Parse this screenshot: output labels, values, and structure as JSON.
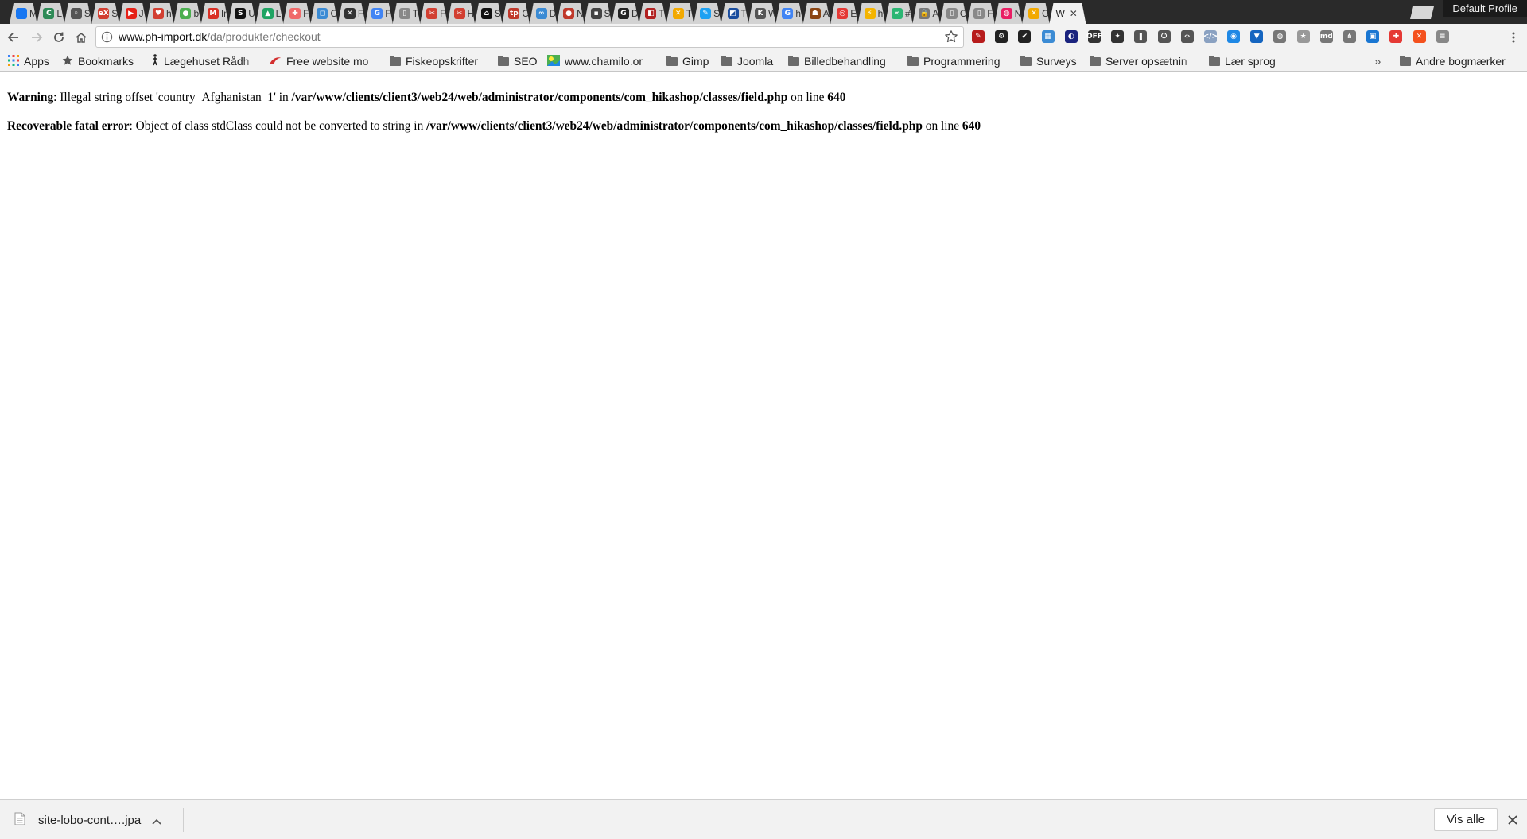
{
  "browser": {
    "profile_label": "Default Profile",
    "tabs": [
      {
        "glyph": "",
        "color": "#1877f2",
        "label": "M"
      },
      {
        "glyph": "C",
        "color": "#2e8b57",
        "label": "L"
      },
      {
        "glyph": "◦",
        "color": "#555555",
        "label": "S"
      },
      {
        "glyph": "eX",
        "color": "#d23f31",
        "label": "S"
      },
      {
        "glyph": "▶",
        "color": "#e62117",
        "label": "J"
      },
      {
        "glyph": "♥",
        "color": "#d23f31",
        "label": "h"
      },
      {
        "glyph": "●",
        "color": "#4caf50",
        "label": "b"
      },
      {
        "glyph": "M",
        "color": "#d93025",
        "label": "In"
      },
      {
        "glyph": "S",
        "color": "#111111",
        "label": "U"
      },
      {
        "glyph": "▲",
        "color": "#1fa463",
        "label": "L"
      },
      {
        "glyph": "✚",
        "color": "#f06a6a",
        "label": "F"
      },
      {
        "glyph": "◻",
        "color": "#3b8bd4",
        "label": "C"
      },
      {
        "glyph": "✕",
        "color": "#333333",
        "label": "F"
      },
      {
        "glyph": "G",
        "color": "#4285f4",
        "label": "F"
      },
      {
        "glyph": "▯",
        "color": "#888888",
        "label": "T"
      },
      {
        "glyph": "✂",
        "color": "#d23f31",
        "label": "F"
      },
      {
        "glyph": "✂",
        "color": "#d23f31",
        "label": "H"
      },
      {
        "glyph": "⌂",
        "color": "#111111",
        "label": "S"
      },
      {
        "glyph": "tp",
        "color": "#c0392b",
        "label": "C"
      },
      {
        "glyph": "∞",
        "color": "#3b8bd4",
        "label": "D"
      },
      {
        "glyph": "●",
        "color": "#c0392b",
        "label": "N"
      },
      {
        "glyph": "▪",
        "color": "#444444",
        "label": "S"
      },
      {
        "glyph": "G",
        "color": "#222222",
        "label": "D"
      },
      {
        "glyph": "◧",
        "color": "#b22222",
        "label": "T"
      },
      {
        "glyph": "✕",
        "color": "#f2a900",
        "label": "T"
      },
      {
        "glyph": "✎",
        "color": "#1da1f2",
        "label": "S"
      },
      {
        "glyph": "◩",
        "color": "#1a4d9e",
        "label": "T"
      },
      {
        "glyph": "K",
        "color": "#555555",
        "label": "W"
      },
      {
        "glyph": "G",
        "color": "#4285f4",
        "label": "h"
      },
      {
        "glyph": "☗",
        "color": "#8b4513",
        "label": "A"
      },
      {
        "glyph": "◎",
        "color": "#e53935",
        "label": "E"
      },
      {
        "glyph": "⚡",
        "color": "#f4b400",
        "label": "h"
      },
      {
        "glyph": "∞",
        "color": "#2bb673",
        "label": "#"
      },
      {
        "glyph": "🔒",
        "color": "#777777",
        "label": "A"
      },
      {
        "glyph": "▯",
        "color": "#888888",
        "label": "C"
      },
      {
        "glyph": "▯",
        "color": "#888888",
        "label": "F"
      },
      {
        "glyph": "◍",
        "color": "#e91e63",
        "label": "N"
      },
      {
        "glyph": "✕",
        "color": "#f2a900",
        "label": "C"
      }
    ],
    "active_tab": {
      "label": "W",
      "close": "✕"
    },
    "url_host": "www.ph-import.dk",
    "url_path": "/da/produkter/checkout",
    "extensions": [
      {
        "name": "eyedropper-ext-icon",
        "color": "#b71c1c",
        "glyph": "✎"
      },
      {
        "name": "settings-ext-icon",
        "color": "#222222",
        "glyph": "⚙"
      },
      {
        "name": "checklist-ext-icon",
        "color": "#222222",
        "glyph": "✔"
      },
      {
        "name": "calendar-ext-icon",
        "color": "#3b8bd4",
        "glyph": "▦"
      },
      {
        "name": "astronomy-ext-icon",
        "color": "#1a237e",
        "glyph": "◐"
      },
      {
        "name": "off-ext-icon",
        "color": "#333333",
        "glyph": "OFF"
      },
      {
        "name": "puzzle-ext-icon",
        "color": "#333333",
        "glyph": "✦"
      },
      {
        "name": "bookmark-ext-icon",
        "color": "#555555",
        "glyph": "❚"
      },
      {
        "name": "power-ext-icon",
        "color": "#555555",
        "glyph": "⏻"
      },
      {
        "name": "code-ext-icon",
        "color": "#555555",
        "glyph": "‹›"
      },
      {
        "name": "html-ext-icon",
        "color": "#8aa1c1",
        "glyph": "</>"
      },
      {
        "name": "ring-ext-icon",
        "color": "#1e88e5",
        "glyph": "◉"
      },
      {
        "name": "shield-ext-icon",
        "color": "#1565c0",
        "glyph": "▼"
      },
      {
        "name": "globe-ext-icon",
        "color": "#777777",
        "glyph": "◍"
      },
      {
        "name": "star-ext-icon",
        "color": "#999999",
        "glyph": "★"
      },
      {
        "name": "md-ext-icon",
        "color": "#777777",
        "glyph": "md"
      },
      {
        "name": "tree-ext-icon",
        "color": "#777777",
        "glyph": "⋔"
      },
      {
        "name": "window-ext-icon",
        "color": "#1976d2",
        "glyph": "▣"
      },
      {
        "name": "lifebuoy-ext-icon",
        "color": "#e53935",
        "glyph": "✚"
      },
      {
        "name": "joomla-ext-icon",
        "color": "#f4511e",
        "glyph": "✕"
      },
      {
        "name": "filter-ext-icon",
        "color": "#888888",
        "glyph": "≡"
      }
    ],
    "bookmarks": [
      {
        "name": "apps",
        "label": "Apps",
        "icon": "apps-grid"
      },
      {
        "name": "bookmarks",
        "label": "Bookmarks",
        "icon": "star"
      },
      {
        "name": "laegehuset",
        "label": "Lægehuset Rådh",
        "icon": "figure"
      },
      {
        "name": "free-website",
        "label": "Free website mo",
        "icon": "red-logo"
      },
      {
        "name": "fiskeopskrifter",
        "label": "Fiskeopskrifter",
        "icon": "folder"
      },
      {
        "name": "seo",
        "label": "SEO",
        "icon": "folder"
      },
      {
        "name": "chamilo",
        "label": "www.chamilo.or",
        "icon": "colorful"
      },
      {
        "name": "gimp",
        "label": "Gimp",
        "icon": "folder"
      },
      {
        "name": "joomla",
        "label": "Joomla",
        "icon": "folder"
      },
      {
        "name": "billedbehandling",
        "label": "Billedbehandling",
        "icon": "folder"
      },
      {
        "name": "programmering",
        "label": "Programmering",
        "icon": "folder"
      },
      {
        "name": "surveys",
        "label": "Surveys",
        "icon": "folder"
      },
      {
        "name": "server",
        "label": "Server opsætnin",
        "icon": "folder"
      },
      {
        "name": "laer-sprog",
        "label": "Lær sprog",
        "icon": "folder"
      }
    ],
    "bookmarks_overflow": "»",
    "other_bookmarks": "Andre bogmærker"
  },
  "page": {
    "line1": {
      "label": "Warning",
      "text": ": Illegal string offset 'country_Afghanistan_1' in ",
      "path": "/var/www/clients/client3/web24/web/administrator/components/com_hikashop/classes/field.php",
      "on_line": " on line ",
      "line_no": "640"
    },
    "line2": {
      "label": "Recoverable fatal error",
      "text": ": Object of class stdClass could not be converted to string in ",
      "path": "/var/www/clients/client3/web24/web/administrator/components/com_hikashop/classes/field.php",
      "on_line": " on line ",
      "line_no": "640"
    }
  },
  "downloads": {
    "file_name": "site-lobo-cont….jpa",
    "show_all": "Vis alle",
    "close": "✕"
  }
}
